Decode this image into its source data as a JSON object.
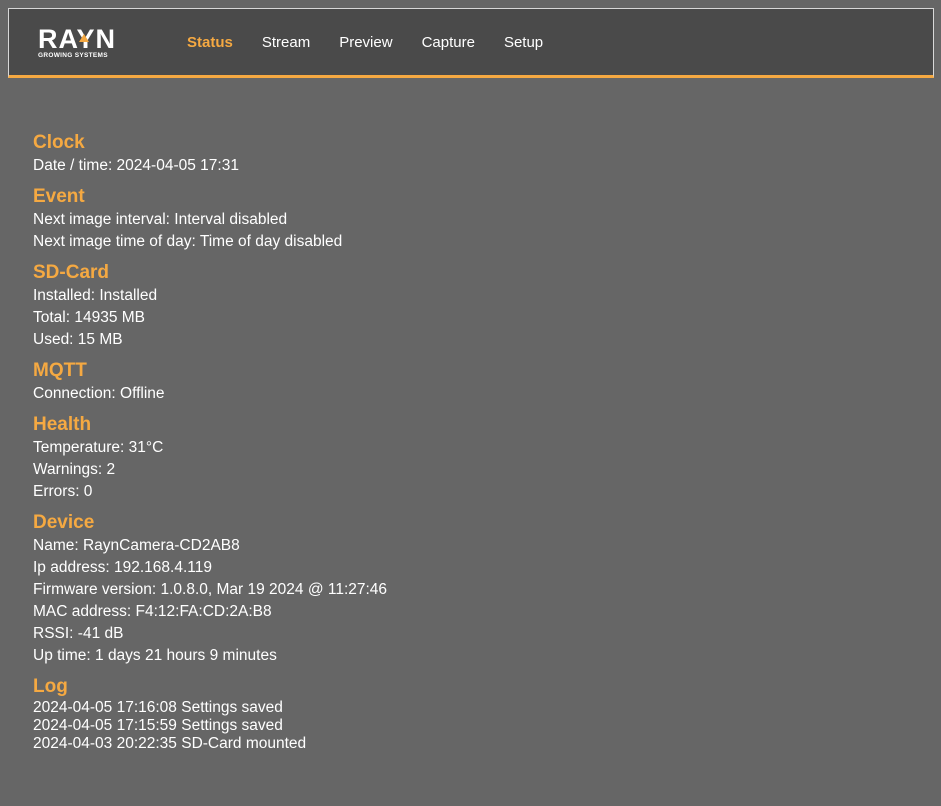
{
  "brand": {
    "name": "RAYN",
    "tagline": "GROWING SYSTEMS",
    "accent_color": "#f5a942"
  },
  "nav": {
    "items": [
      {
        "label": "Status",
        "active": true
      },
      {
        "label": "Stream",
        "active": false
      },
      {
        "label": "Preview",
        "active": false
      },
      {
        "label": "Capture",
        "active": false
      },
      {
        "label": "Setup",
        "active": false
      }
    ]
  },
  "sections": {
    "clock": {
      "title": "Clock",
      "lines": [
        "Date / time: 2024-04-05 17:31"
      ]
    },
    "event": {
      "title": "Event",
      "lines": [
        "Next image interval: Interval disabled",
        "Next image time of day: Time of day disabled"
      ]
    },
    "sdcard": {
      "title": "SD-Card",
      "lines": [
        "Installed: Installed",
        "Total: 14935 MB",
        "Used: 15 MB"
      ]
    },
    "mqtt": {
      "title": "MQTT",
      "lines": [
        "Connection: Offline"
      ]
    },
    "health": {
      "title": "Health",
      "lines": [
        "Temperature: 31°C",
        "Warnings: 2",
        "Errors: 0"
      ]
    },
    "device": {
      "title": "Device",
      "lines": [
        "Name: RaynCamera-CD2AB8",
        "Ip address: 192.168.4.119",
        "Firmware version: 1.0.8.0, Mar 19 2024 @ 11:27:46",
        "MAC address: F4:12:FA:CD:2A:B8",
        "RSSI: -41 dB",
        "Up time: 1 days 21 hours 9 minutes"
      ]
    },
    "log": {
      "title": "Log",
      "lines": [
        "2024-04-05 17:16:08 Settings saved",
        "2024-04-05 17:15:59 Settings saved",
        "2024-04-03 20:22:35 SD-Card mounted"
      ]
    }
  }
}
